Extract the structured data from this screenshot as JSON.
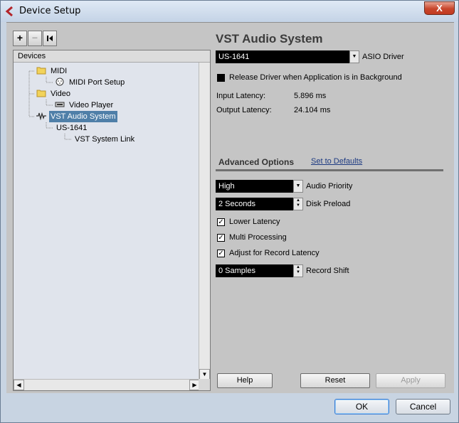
{
  "window": {
    "title": "Device Setup",
    "close_label": "X"
  },
  "toolbar": {
    "add_label": "+",
    "remove_label": "−",
    "reset_label": "|◂"
  },
  "devices": {
    "header": "Devices",
    "tree": [
      {
        "label": "MIDI",
        "icon": "folder-icon"
      },
      {
        "label": "MIDI Port Setup",
        "icon": "midi-port-icon"
      },
      {
        "label": "Video",
        "icon": "folder-icon"
      },
      {
        "label": "Video Player",
        "icon": "video-player-icon"
      },
      {
        "label": "VST Audio System",
        "icon": "audio-system-icon",
        "selected": true
      },
      {
        "label": "US-1641",
        "icon": ""
      },
      {
        "label": "VST System Link",
        "icon": ""
      }
    ]
  },
  "vst": {
    "heading": "VST Audio System",
    "asio_driver_value": "US-1641",
    "asio_driver_label": "ASIO Driver",
    "release_driver_label": "Release Driver when Application is in Background",
    "release_driver_checked": false,
    "input_latency_label": "Input Latency:",
    "input_latency_value": "5.896 ms",
    "output_latency_label": "Output Latency:",
    "output_latency_value": "24.104 ms"
  },
  "advanced": {
    "tab_label": "Advanced Options",
    "defaults_link": "Set to Defaults",
    "audio_priority_value": "High",
    "audio_priority_label": "Audio Priority",
    "disk_preload_value": "2 Seconds",
    "disk_preload_label": "Disk Preload",
    "lower_latency_label": "Lower Latency",
    "lower_latency_checked": true,
    "multi_processing_label": "Multi Processing",
    "multi_processing_checked": true,
    "adjust_record_latency_label": "Adjust for Record Latency",
    "adjust_record_latency_checked": true,
    "record_shift_value": "0 Samples",
    "record_shift_label": "Record Shift",
    "checkmark": "✓"
  },
  "actions": {
    "help": "Help",
    "reset": "Reset",
    "apply": "Apply"
  },
  "footer": {
    "ok": "OK",
    "cancel": "Cancel"
  },
  "colors": {
    "selected_bg": "#4f7fa8",
    "title_bar": "#c4d3e6",
    "close_red": "#c8462c"
  }
}
